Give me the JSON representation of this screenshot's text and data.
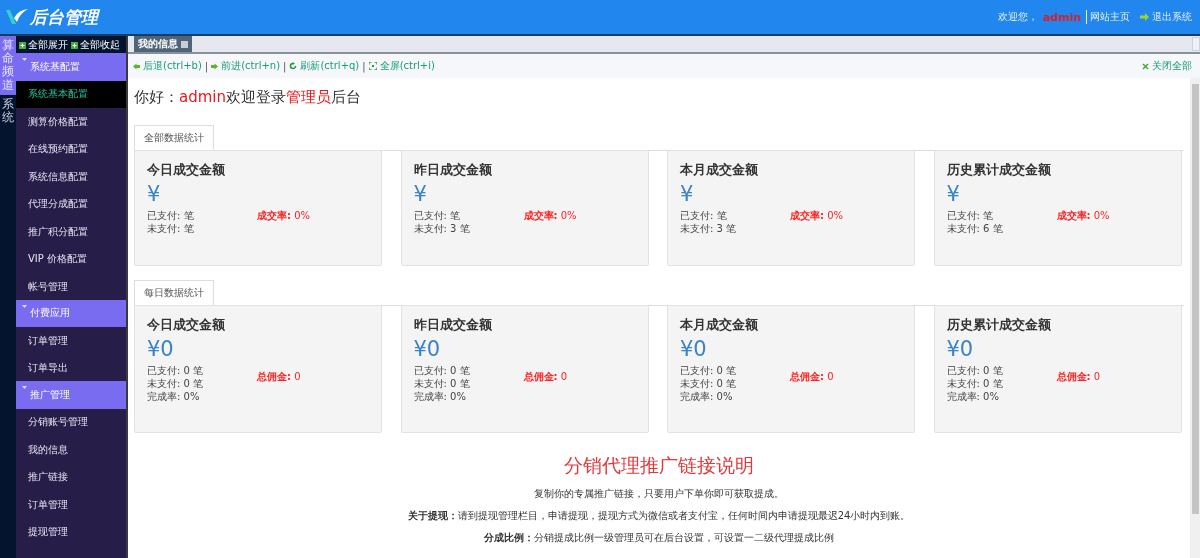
{
  "header": {
    "logo": "后台管理",
    "welcome": "欢迎您，",
    "user": "admin",
    "site_link": "网站主页",
    "logout": "退出系统"
  },
  "channels": [
    {
      "label": "算命频道",
      "selected": true
    },
    {
      "label": "系统",
      "selected": false
    }
  ],
  "sidebar": {
    "expand_all": "全部展开",
    "collapse_all": "全部收起",
    "groups": [
      {
        "title": "系统基配置",
        "expanded": true,
        "items": [
          {
            "label": "系统基本配置",
            "selected": true
          },
          {
            "label": "测算价格配置",
            "selected": false
          },
          {
            "label": "在线预约配置",
            "selected": false
          },
          {
            "label": "系统信息配置",
            "selected": false
          },
          {
            "label": "代理分成配置",
            "selected": false
          },
          {
            "label": "推广积分配置",
            "selected": false
          },
          {
            "label": "VIP 价格配置",
            "selected": false
          },
          {
            "label": "帐号管理",
            "selected": false
          }
        ]
      },
      {
        "title": "付费应用",
        "expanded": true,
        "items": [
          {
            "label": "订单管理",
            "selected": false
          },
          {
            "label": "订单导出",
            "selected": false
          }
        ]
      },
      {
        "title": "推广管理",
        "expanded": true,
        "items": [
          {
            "label": "分销账号管理",
            "selected": false
          },
          {
            "label": "我的信息",
            "selected": false
          },
          {
            "label": "推广链接",
            "selected": false
          },
          {
            "label": "订单管理",
            "selected": false
          },
          {
            "label": "提现管理",
            "selected": false
          }
        ]
      }
    ]
  },
  "tabs": [
    {
      "label": "我的信息",
      "selected": true
    }
  ],
  "toolbar": {
    "actions": [
      {
        "kind": "back",
        "label": "后退(ctrl+b)"
      },
      {
        "kind": "forward",
        "label": "前进(ctrl+n)"
      },
      {
        "kind": "refresh",
        "label": "刷新(ctrl+q)"
      },
      {
        "kind": "fullscreen",
        "label": "全屏(ctrl+i)"
      }
    ],
    "close_all": "关闭全部",
    "separator": "|"
  },
  "greeting": [
    {
      "kind": "plain",
      "text": "你好："
    },
    {
      "kind": "highlight",
      "text": "admin"
    },
    {
      "kind": "plain",
      "text": "欢迎登录"
    },
    {
      "kind": "highlight",
      "text": "管理员"
    },
    {
      "kind": "plain",
      "text": "后台"
    }
  ],
  "stat_sections": [
    {
      "label": "全部数据统计",
      "cards": [
        {
          "title": "今日成交金额",
          "amount": "¥",
          "lines": [
            "已支付: 笔",
            "未支付: 笔"
          ],
          "stat_label": "成交率:",
          "stat_value": "0%"
        },
        {
          "title": "昨日成交金额",
          "amount": "¥",
          "lines": [
            "已支付: 笔",
            "未支付: 3 笔"
          ],
          "stat_label": "成交率:",
          "stat_value": "0%"
        },
        {
          "title": "本月成交金额",
          "amount": "¥",
          "lines": [
            "已支付: 笔",
            "未支付: 3 笔"
          ],
          "stat_label": "成交率:",
          "stat_value": "0%"
        },
        {
          "title": "历史累计成交金额",
          "amount": "¥",
          "lines": [
            "已支付: 笔",
            "未支付: 6 笔"
          ],
          "stat_label": "成交率:",
          "stat_value": "0%"
        }
      ]
    },
    {
      "label": "每日数据统计",
      "cards": [
        {
          "title": "今日成交金额",
          "amount": "¥0",
          "lines": [
            "已支付: 0 笔",
            "未支付: 0 笔",
            "完成率: 0%"
          ],
          "stat_label": "总佣金:",
          "stat_value": "0"
        },
        {
          "title": "昨日成交金额",
          "amount": "¥0",
          "lines": [
            "已支付: 0 笔",
            "未支付: 0 笔",
            "完成率: 0%"
          ],
          "stat_label": "总佣金:",
          "stat_value": "0"
        },
        {
          "title": "本月成交金额",
          "amount": "¥0",
          "lines": [
            "已支付: 0 笔",
            "未支付: 0 笔",
            "完成率: 0%"
          ],
          "stat_label": "总佣金:",
          "stat_value": "0"
        },
        {
          "title": "历史累计成交金额",
          "amount": "¥0",
          "lines": [
            "已支付: 0 笔",
            "未支付: 0 笔",
            "完成率: 0%"
          ],
          "stat_label": "总佣金:",
          "stat_value": "0"
        }
      ]
    }
  ],
  "promo": {
    "title": "分销代理推广链接说明",
    "paragraphs": [
      "复制你的专属推广链接，只要用户下单你即可获取提成。",
      "**关于提现：**请到提现管理栏目，申请提现，提现方式为微信或者支付宝，任何时间内申请提现最迟24小时内到账。",
      "**分成比例：**分销提成比例一级管理员可在后台设置，可设置一二级代理提成比例"
    ]
  }
}
